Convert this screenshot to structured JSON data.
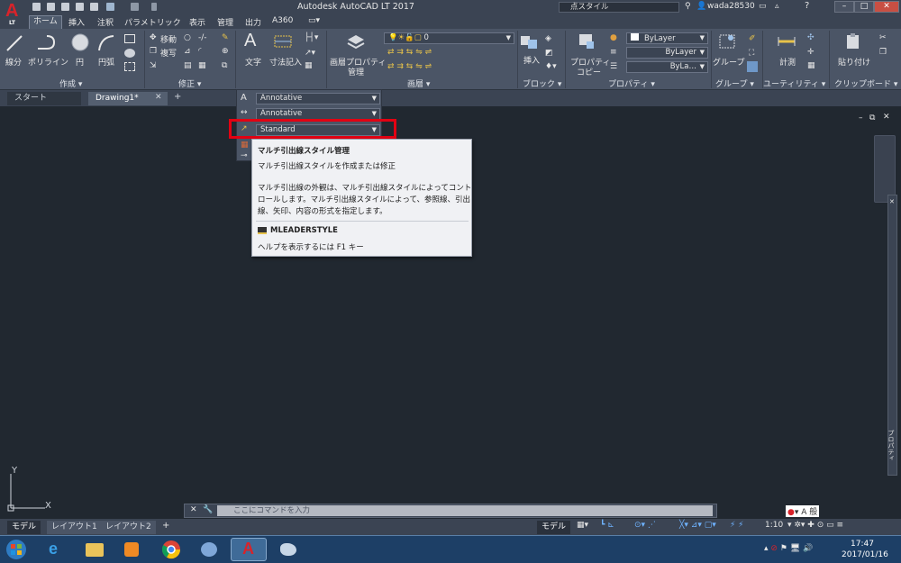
{
  "app": {
    "title": "Autodesk AutoCAD LT 2017",
    "logo_letter": "A",
    "logo_sub": "LT"
  },
  "header": {
    "search_placeholder": "点スタイル",
    "user": "wada28530"
  },
  "ribbon_tabs": [
    "ホーム",
    "挿入",
    "注釈",
    "パラメトリック",
    "表示",
    "管理",
    "出力",
    "A360"
  ],
  "draw_panel": {
    "line": "線分",
    "polyline": "ポリライン",
    "circle": "円",
    "arc": "円弧",
    "title": "作成 ▾"
  },
  "modify_panel": {
    "move": "移動",
    "copy": "複写",
    "title": "修正 ▾"
  },
  "annotation_panel": {
    "text": "文字",
    "dimension": "寸法記入",
    "title": "注釈 ▾",
    "text_style": "Annotative",
    "dim_style": "Annotative",
    "mleader_style": "Standard"
  },
  "layers_panel": {
    "layer_properties": "画層プロパティ管理",
    "layer_name": "0",
    "title": "画層 ▾"
  },
  "block_panel": {
    "insert": "挿入",
    "title": "ブロック ▾"
  },
  "properties_panel": {
    "match": "プロパティコピー",
    "color": "ByLayer",
    "linetype": "ByLayer",
    "lineweight": "ByLa…",
    "title": "プロパティ ▾"
  },
  "groups_panel": {
    "group": "グループ",
    "title": "グループ ▾"
  },
  "utilities_panel": {
    "measure": "計測",
    "title": "ユーティリティ ▾"
  },
  "clipboard_panel": {
    "paste": "貼り付け",
    "title": "クリップボード ▾"
  },
  "doc_tabs": [
    "スタート",
    "Drawing1*"
  ],
  "tooltip": {
    "title": "マルチ引出線スタイル管理",
    "subtitle": "マルチ引出線スタイルを作成または修正",
    "line1": "マルチ引出線の外観は、マルチ引出線スタイルによってコント",
    "line2": "ロールします。マルチ引出線スタイルによって、参照線、引出",
    "line3": "線、矢印、内容の形式を指定します。",
    "command": "MLEADERSTYLE",
    "help": "ヘルプを表示するには F1 キー"
  },
  "palette_strip_label": "プロパティ",
  "command_line": {
    "placeholder": "ここにコマンドを入力"
  },
  "layout_tabs": [
    "モデル",
    "レイアウト1",
    "レイアウト2"
  ],
  "status": {
    "model": "モデル",
    "scale": "1:10"
  },
  "tray": {
    "ime": "A 般",
    "time": "17:47",
    "date": "2017/01/16"
  }
}
